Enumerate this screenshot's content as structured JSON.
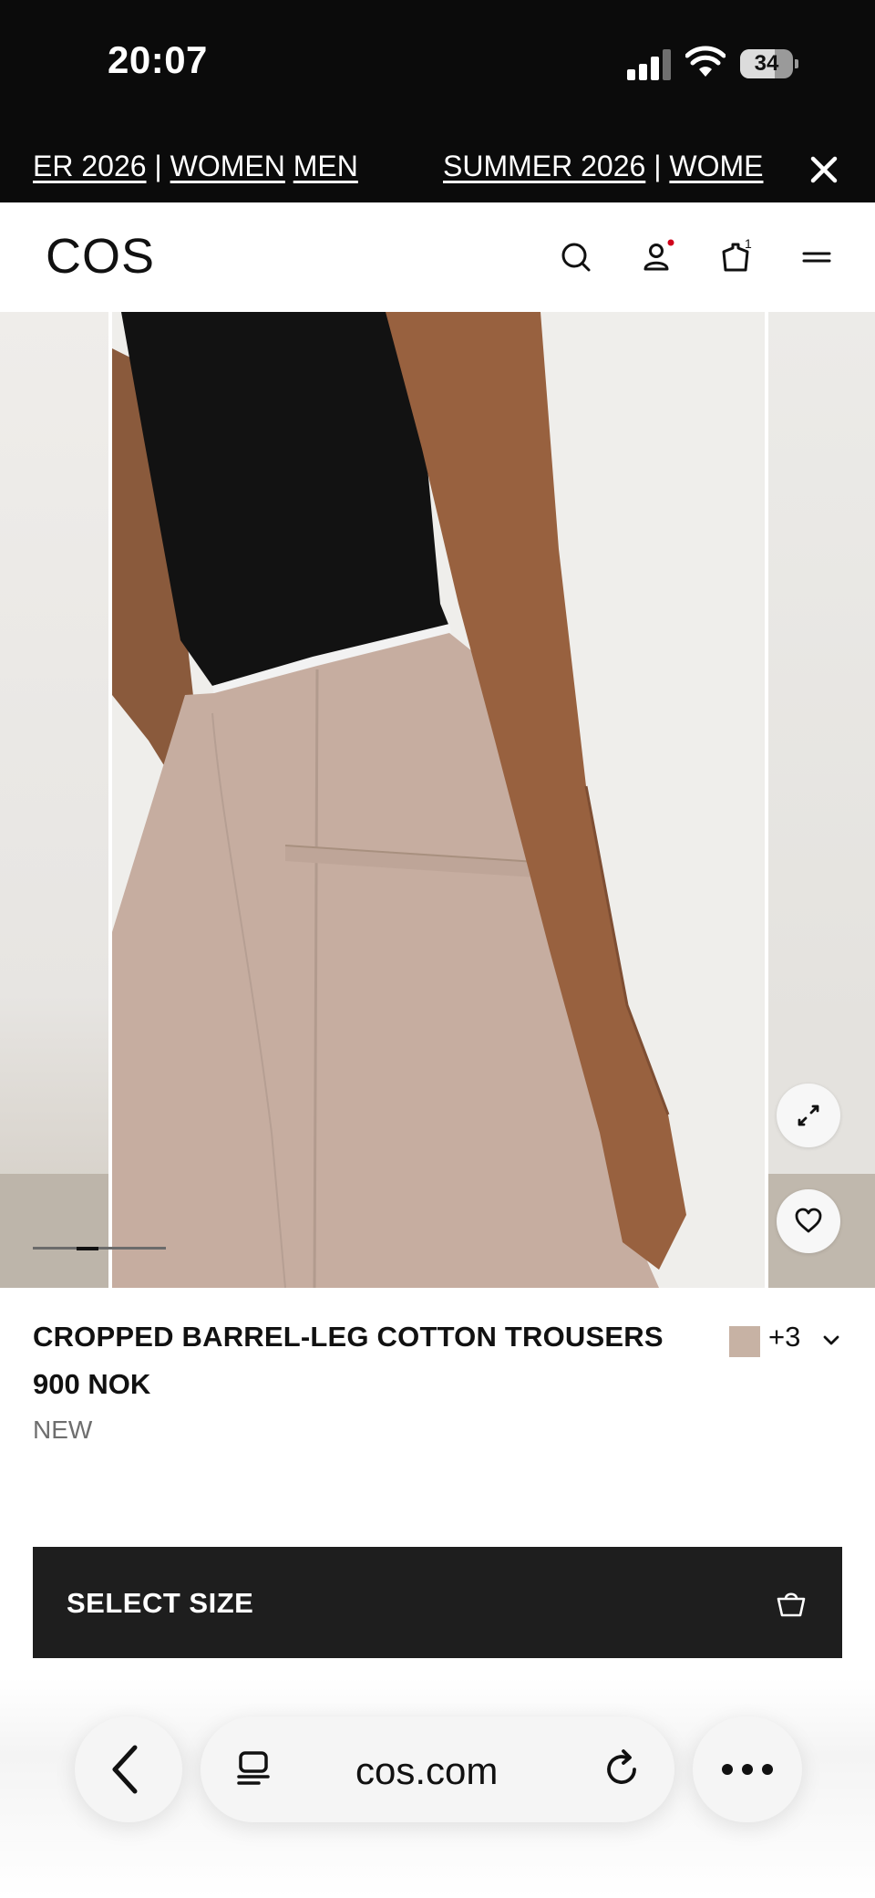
{
  "status_bar": {
    "time": "20:07",
    "battery": "34"
  },
  "promo": {
    "segment_1": {
      "part_a": "ER 2026",
      "sep": " | ",
      "part_b": "WOMEN",
      "part_c": "MEN"
    },
    "segment_2": {
      "part_a": "SUMMER 2026",
      "sep": " | ",
      "part_b": "WOME"
    }
  },
  "header": {
    "logo": "COS"
  },
  "gallery": {
    "slide_count": 4,
    "active_index": 1
  },
  "product": {
    "title": "CROPPED BARREL-LEG COTTON TROUSERS",
    "price": "900 NOK",
    "badge": "NEW",
    "swatch_color": "#c7b2a4",
    "more_colors": "+3"
  },
  "cta": {
    "label": "SELECT SIZE"
  },
  "browser": {
    "url": "cos.com"
  },
  "colors": {
    "status_bg": "#0b0b0b",
    "cta_bg": "#1e1e1e",
    "trouser": "#c7b2a4",
    "notification_dot": "#d0021b"
  }
}
